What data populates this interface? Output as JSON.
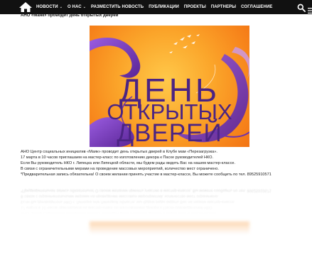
{
  "nav": {
    "items": [
      {
        "label": "НОВОСТИ",
        "dropdown": true
      },
      {
        "label": "О НАС",
        "dropdown": true
      },
      {
        "label": "РАЗМЕСТИТЬ НОВОСТЬ",
        "dropdown": false
      },
      {
        "label": "ПУБЛИКАЦИИ",
        "dropdown": false
      },
      {
        "label": "ПРОЕКТЫ",
        "dropdown": false
      },
      {
        "label": "ПАРТНЕРЫ",
        "dropdown": false
      },
      {
        "label": "СОГЛАШЕНИЕ",
        "dropdown": false
      }
    ],
    "caret": "⌄",
    "icons": {
      "home": "home-icon",
      "search": "search-icon",
      "menu": "menu-icon"
    },
    "bar_color": "#111111"
  },
  "article": {
    "title": "АНО «Маяк» проводит день открытых дверей",
    "poster": {
      "line1": "ДЕНЬ",
      "line2": "ОТКРЫТЫХ",
      "line3": "ДВЕРЕЙ",
      "background": "#f89a25",
      "text_color": "#4b2483",
      "ribbon_color": "#7b3fc4"
    },
    "paragraphs": [
      "АНО Центр социальных инициатив «Маяк» проводит день открытых дверей в Клубе мам «Перезагрузка».",
      "17 марта в 10 часов приглашаем на мастер-класс по изготовлению декора к Пасхе руководителей НКО.",
      "Если Вы руководитель НКО г. Липецка или Липецкой области, мы будем рады видеть Вас на нашем мастер-классе.",
      "В связи с ограничительными мерами на проведение массовых мероприятий, количество мест ограничено.",
      "*Предварительная запись обязательна! О своем желании принять участие в мастер-классе, Вы можете сообщить по тел. 89525910571"
    ]
  }
}
